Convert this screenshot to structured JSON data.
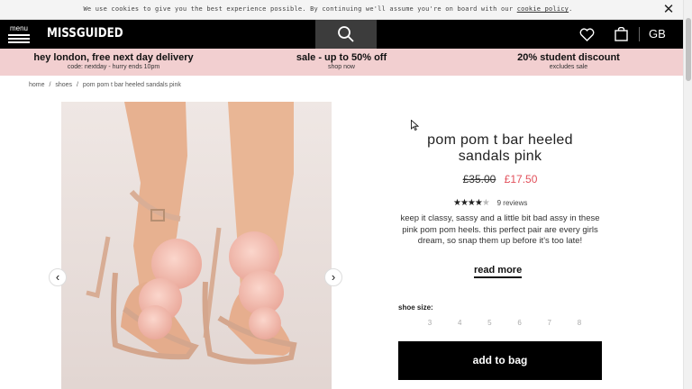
{
  "cookie_bar": {
    "message": "We use cookies to give you the best experience possible. By continuing we'll assume you're on board with our",
    "link": "cookie policy",
    "suffix": "."
  },
  "nav": {
    "menu_label": "menu",
    "logo": "MISSGUIDED",
    "region": "GB"
  },
  "promos": [
    {
      "title": "hey london, free next day delivery",
      "sub": "code: nextday - hurry ends 10pm"
    },
    {
      "title": "sale - up to 50% off",
      "sub": "shop now"
    },
    {
      "title": "20% student discount",
      "sub": "excludes sale"
    }
  ],
  "breadcrumb": [
    "home",
    "/",
    "shoes",
    "/",
    "pom pom t bar heeled sandals pink"
  ],
  "product": {
    "title_line1": "pom pom t bar heeled",
    "title_line2": "sandals pink",
    "price_old": "£35.00",
    "price_new": "£17.50",
    "rating": 4,
    "rating_max": 5,
    "reviews": "9 reviews",
    "description": "keep it classy, sassy and a little bit bad assy in these pink pom pom heels. this perfect pair are every girls dream, so snap them up before it's too late!",
    "read_more": "read more",
    "size_label": "shoe size:",
    "sizes": [
      "3",
      "4",
      "5",
      "6",
      "7",
      "8"
    ],
    "add_to_bag": "add to bag"
  },
  "colors": {
    "promo_bg": "#f2cfd0",
    "sale_price": "#e2505b",
    "nav_bg": "#000000"
  }
}
